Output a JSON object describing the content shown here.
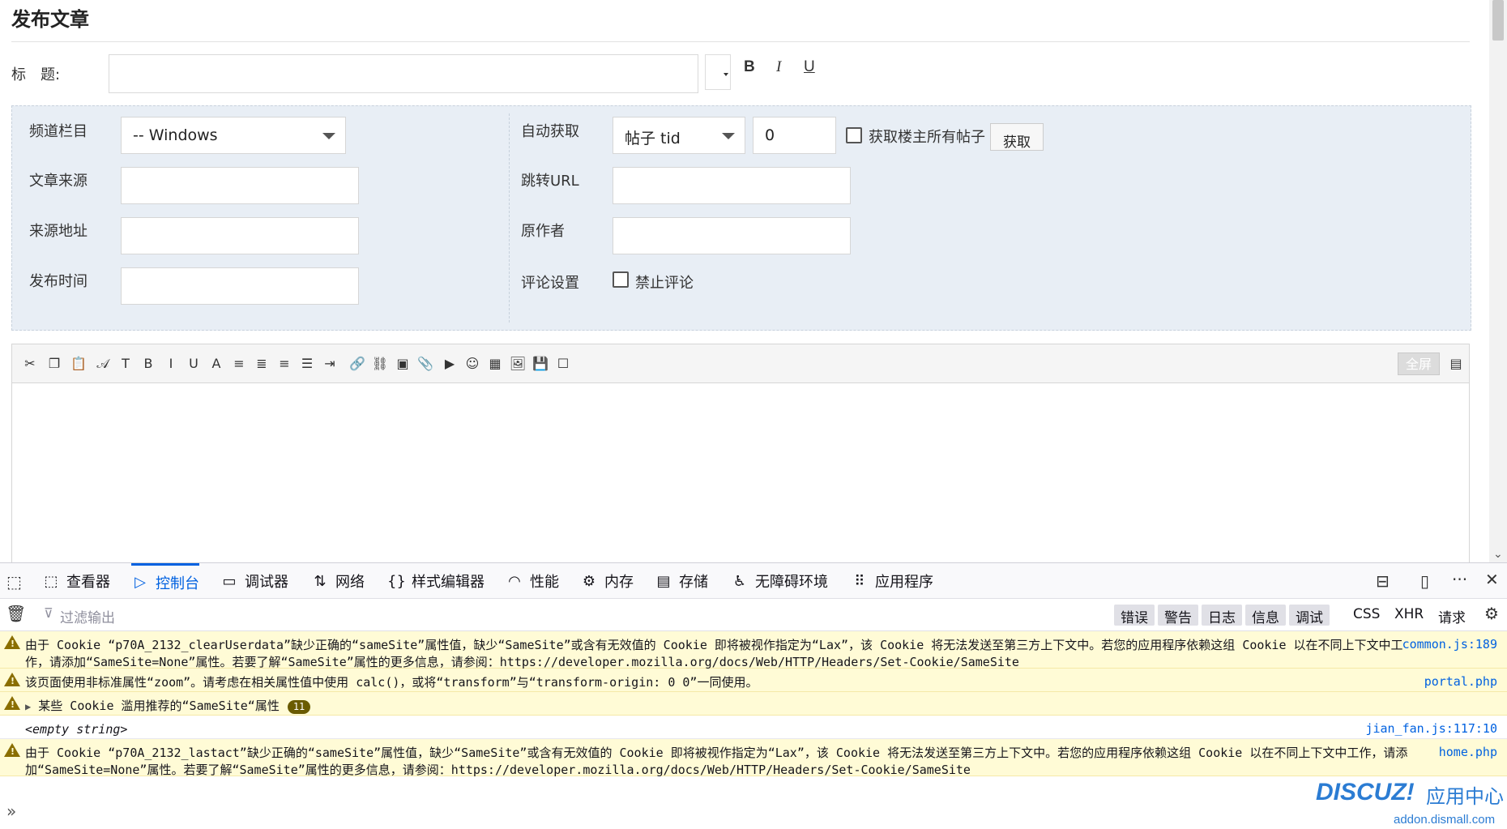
{
  "page": {
    "title": "发布文章",
    "title_label": "标　题:",
    "format": {
      "bold": "B",
      "italic": "I",
      "underline": "U"
    }
  },
  "meta": {
    "channel_label": "频道栏目",
    "channel_value": "-- Windows",
    "auto_fetch_label": "自动获取",
    "tid_select": "帖子 tid",
    "tid_value": "0",
    "all_posts_label": "获取楼主所有帖子",
    "fetch_button": "获取",
    "source_label": "文章来源",
    "redirect_label": "跳转URL",
    "source_url_label": "来源地址",
    "author_label": "原作者",
    "publish_time_label": "发布时间",
    "comment_label": "评论设置",
    "disable_comment_label": "禁止评论"
  },
  "editor": {
    "fullscreen": "全屏",
    "toolbar_icons": [
      "cut-icon",
      "copy-icon",
      "paste-icon",
      "font-family-icon",
      "font-size-icon",
      "bold-icon",
      "italic-icon",
      "underline-icon",
      "font-color-icon",
      "align-left-icon",
      "align-center-icon",
      "align-right-icon",
      "ordered-list-icon",
      "indent-icon",
      "link-icon",
      "unlink-icon",
      "image-icon",
      "attachment-icon",
      "video-icon",
      "emoji-icon",
      "table-icon",
      "insert-image-icon",
      "save-icon",
      "checkbox-icon"
    ]
  },
  "devtools": {
    "tabs": [
      {
        "label": "查看器",
        "icon": "inspector-icon"
      },
      {
        "label": "控制台",
        "icon": "console-icon"
      },
      {
        "label": "调试器",
        "icon": "debugger-icon"
      },
      {
        "label": "网络",
        "icon": "network-icon"
      },
      {
        "label": "样式编辑器",
        "icon": "style-editor-icon"
      },
      {
        "label": "性能",
        "icon": "performance-icon"
      },
      {
        "label": "内存",
        "icon": "memory-icon"
      },
      {
        "label": "存储",
        "icon": "storage-icon"
      },
      {
        "label": "无障碍环境",
        "icon": "accessibility-icon"
      },
      {
        "label": "应用程序",
        "icon": "application-icon"
      }
    ],
    "filter_placeholder": "过滤输出",
    "levels": [
      "错误",
      "警告",
      "日志",
      "信息",
      "调试"
    ],
    "extra_filters": [
      "CSS",
      "XHR",
      "请求"
    ],
    "messages": [
      {
        "type": "warning",
        "text": "由于 Cookie “p70A_2132_clearUserdata”缺少正确的“sameSite”属性值，缺少“SameSite”或含有无效值的 Cookie 即将被视作指定为“Lax”，该 Cookie 将无法发送至第三方上下文中。若您的应用程序依赖这组 Cookie 以在不同上下文中工作，请添加“SameSite=None”属性。若要了解“SameSite”属性的更多信息，请参阅：https://developer.mozilla.org/docs/Web/HTTP/Headers/Set-Cookie/SameSite",
        "source": "common.js:189"
      },
      {
        "type": "warning",
        "text": "该页面使用非标准属性“zoom”。请考虑在相关属性值中使用 calc()，或将“transform”与“transform-origin: 0 0”一同使用。",
        "source": "portal.php"
      },
      {
        "type": "warning-group",
        "text": "某些 Cookie 滥用推荐的“SameSite“属性",
        "count": "11"
      },
      {
        "type": "log",
        "text": "<empty string>",
        "source": "jian_fan.js:117:10"
      },
      {
        "type": "warning",
        "text": "由于 Cookie “p70A_2132_lastact”缺少正确的“sameSite”属性值，缺少“SameSite”或含有无效值的 Cookie 即将被视作指定为“Lax”，该 Cookie 将无法发送至第三方上下文中。若您的应用程序依赖这组 Cookie 以在不同上下文中工作，请添加“SameSite=None”属性。若要了解“SameSite”属性的更多信息，请参阅：https://developer.mozilla.org/docs/Web/HTTP/Headers/Set-Cookie/SameSite",
        "source": "home.php"
      }
    ],
    "prompt": "»",
    "watermark": {
      "main": "DISCUZ!",
      "sub": "应用中心",
      "url": "addon.dismall.com"
    }
  }
}
